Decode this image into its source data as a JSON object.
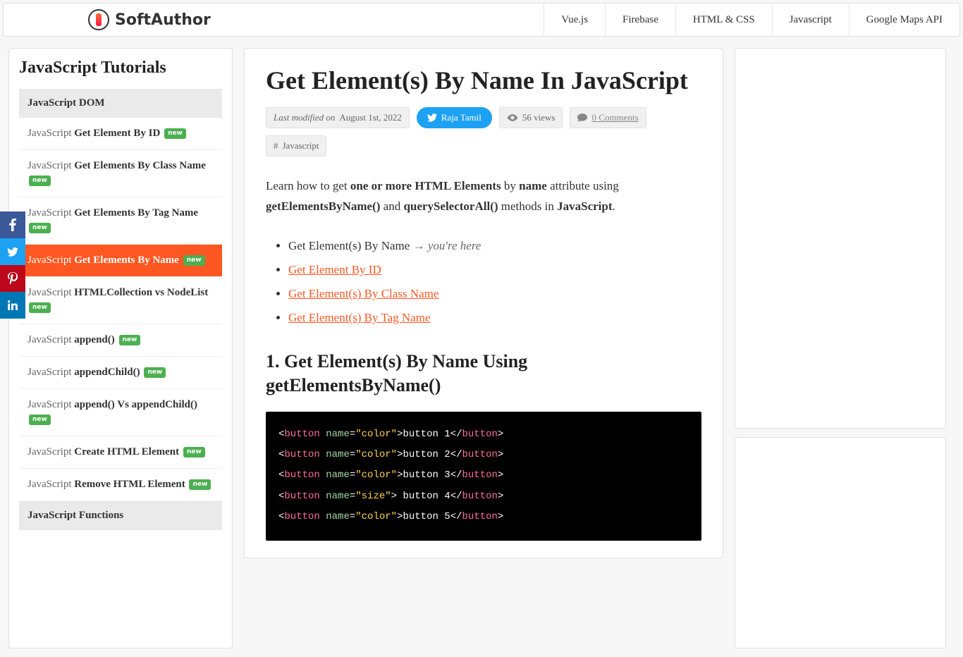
{
  "brand": "SoftAuthor",
  "nav": [
    "Vue.js",
    "Firebase",
    "HTML & CSS",
    "Javascript",
    "Google Maps API"
  ],
  "sidebar": {
    "title": "JavaScript Tutorials",
    "section1": "JavaScript DOM",
    "items": [
      {
        "prefix": "JavaScript ",
        "main": "Get Element By ID",
        "new": true,
        "active": false
      },
      {
        "prefix": "JavaScript ",
        "main": "Get Elements By Class Name",
        "new": true,
        "active": false
      },
      {
        "prefix": "JavaScript ",
        "main": "Get Elements By Tag Name",
        "new": true,
        "active": false
      },
      {
        "prefix": "JavaScript ",
        "main": "Get Elements By Name",
        "new": true,
        "active": true
      },
      {
        "prefix": "JavaScript ",
        "main": "HTMLCollection vs NodeList",
        "new": true,
        "active": false
      },
      {
        "prefix": "JavaScript ",
        "main": "append()",
        "new": true,
        "active": false
      },
      {
        "prefix": "JavaScript ",
        "main": "appendChild()",
        "new": true,
        "active": false
      },
      {
        "prefix": "JavaScript ",
        "main": "append() Vs appendChild()",
        "new": true,
        "active": false
      },
      {
        "prefix": "JavaScript ",
        "main": "Create HTML Element",
        "new": true,
        "active": false
      },
      {
        "prefix": "JavaScript ",
        "main": "Remove HTML Element",
        "new": true,
        "active": false
      }
    ],
    "section2": "JavaScript Functions",
    "badge_new": "new"
  },
  "article": {
    "title": "Get Element(s) By Name In JavaScript",
    "modified_label": "Last modified on",
    "modified_date": "August 1st, 2022",
    "author": "Raja Tamil",
    "views": "56 views",
    "comments": "0 Comments",
    "tag": "Javascript",
    "intro_parts": {
      "p1": "Learn how to get ",
      "b1": "one or more HTML Elements",
      "p2": " by ",
      "b2": "name",
      "p3": " attribute using ",
      "b3": "getElementsByName()",
      "p4": " and ",
      "b4": "querySelectorAll()",
      "p5": " methods in ",
      "b5": "JavaScript",
      "p6": "."
    },
    "toc": [
      {
        "text": "Get Element(s) By Name",
        "here": "→ you're here",
        "current": true
      },
      {
        "text": "Get Element By ID",
        "current": false
      },
      {
        "text": "Get Element(s) By Class Name",
        "current": false
      },
      {
        "text": "Get Element(s) By Tag Name",
        "current": false
      }
    ],
    "h2": "1. Get Element(s) By Name Using getElementsByName()",
    "code_lines": [
      {
        "name": "color",
        "text": "button 1"
      },
      {
        "name": "color",
        "text": "button 2"
      },
      {
        "name": "color",
        "text": "button 3"
      },
      {
        "name": "size",
        "text": " button 4"
      },
      {
        "name": "color",
        "text": "button 5"
      }
    ]
  }
}
